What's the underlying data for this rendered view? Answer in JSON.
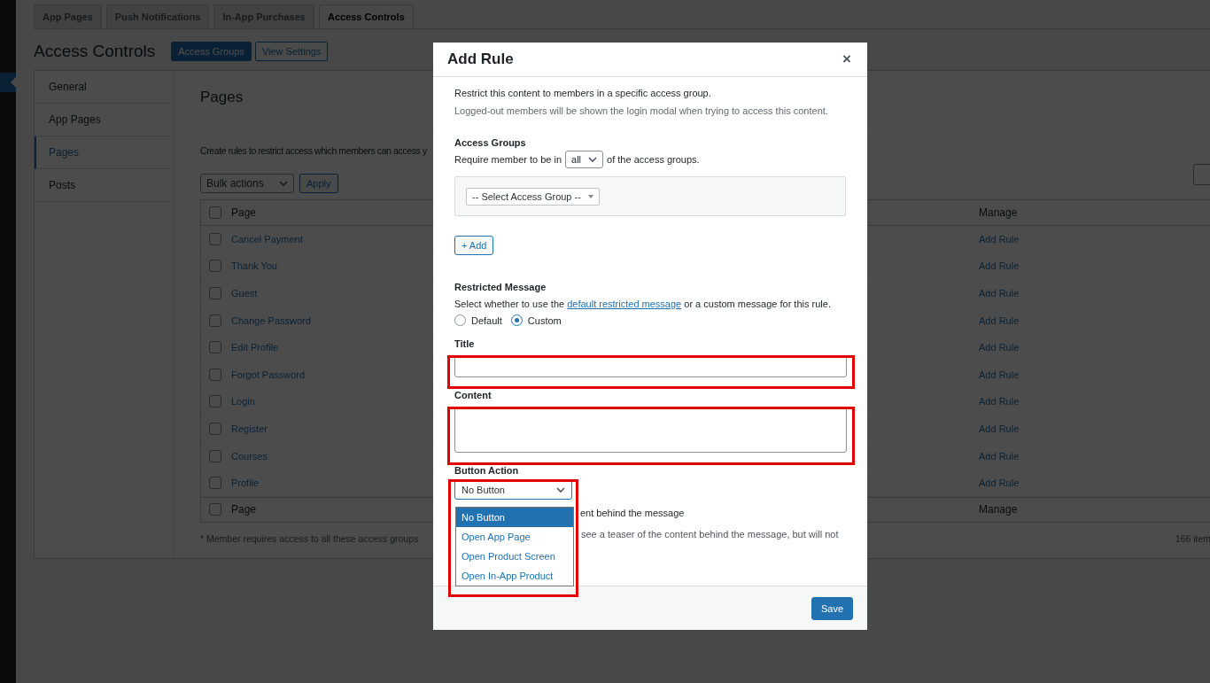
{
  "tabs": [
    {
      "label": "App Pages",
      "selected": false
    },
    {
      "label": "Push Notifications",
      "selected": false
    },
    {
      "label": "In-App Purchases",
      "selected": false
    },
    {
      "label": "Access Controls",
      "selected": true
    }
  ],
  "page_title": "Access Controls",
  "header_buttons": [
    {
      "label": "Access Groups",
      "kind": "primary"
    },
    {
      "label": "View Settings",
      "kind": "secondary"
    }
  ],
  "nav": [
    {
      "label": "General",
      "selected": false
    },
    {
      "label": "App Pages",
      "selected": false
    },
    {
      "label": "Pages",
      "selected": true
    },
    {
      "label": "Posts",
      "selected": false
    }
  ],
  "section_title": "Pages",
  "description": "Create rules to restrict access which members can access y",
  "bulk": {
    "value": "Bulk actions",
    "apply": "Apply"
  },
  "table": {
    "columns": [
      "Page",
      "Manage"
    ],
    "header_checked": false,
    "footer_checked": false,
    "rows": [
      {
        "page": "Cancel Payment",
        "manage": "Add Rule",
        "checked": false
      },
      {
        "page": "Thank You",
        "manage": "Add Rule",
        "checked": false
      },
      {
        "page": "Guest",
        "manage": "Add Rule",
        "checked": false
      },
      {
        "page": "Change Password",
        "manage": "Add Rule",
        "checked": false
      },
      {
        "page": "Edit Profile",
        "manage": "Add Rule",
        "checked": false
      },
      {
        "page": "Forgot Password",
        "manage": "Add Rule",
        "checked": false
      },
      {
        "page": "Login",
        "manage": "Add Rule",
        "checked": false
      },
      {
        "page": "Register",
        "manage": "Add Rule",
        "checked": false
      },
      {
        "page": "Courses",
        "manage": "Add Rule",
        "checked": false
      },
      {
        "page": "Profile",
        "manage": "Add Rule",
        "checked": false
      }
    ],
    "footer": [
      "Page",
      "Manage"
    ]
  },
  "footnote": "* Member requires access to all these access groups",
  "item_count": "166 item",
  "modal": {
    "title": "Add Rule",
    "close": "×",
    "intro": "Restrict this content to members in a specific access group.",
    "note": "Logged-out members will be shown the login modal when trying to access this content.",
    "groups_label": "Access Groups",
    "require_prefix": "Require member to be in",
    "require_value": "all",
    "require_suffix": "of the access groups.",
    "group_select": "-- Select Access Group --",
    "add_button": "+ Add",
    "message_label": "Restricted Message",
    "message_before": "Select whether to use the ",
    "message_link": "default restricted message",
    "message_after": " or a custom message for this rule.",
    "message_options": [
      {
        "label": "Default",
        "selected": false
      },
      {
        "label": "Custom",
        "selected": true
      }
    ],
    "title_label": "Title",
    "content_label": "Content",
    "action_label": "Button Action",
    "action_value": "No Button",
    "action_options": [
      {
        "label": "No Button",
        "selected": true
      },
      {
        "label": "Open App Page",
        "selected": false
      },
      {
        "label": "Open Product Screen",
        "selected": false
      },
      {
        "label": "Open In-App Product",
        "selected": false
      }
    ],
    "teaser_label_fragment": "ent behind the message",
    "teaser_help_fragment": "see a teaser of the content behind the message, but will not",
    "save": "Save"
  }
}
